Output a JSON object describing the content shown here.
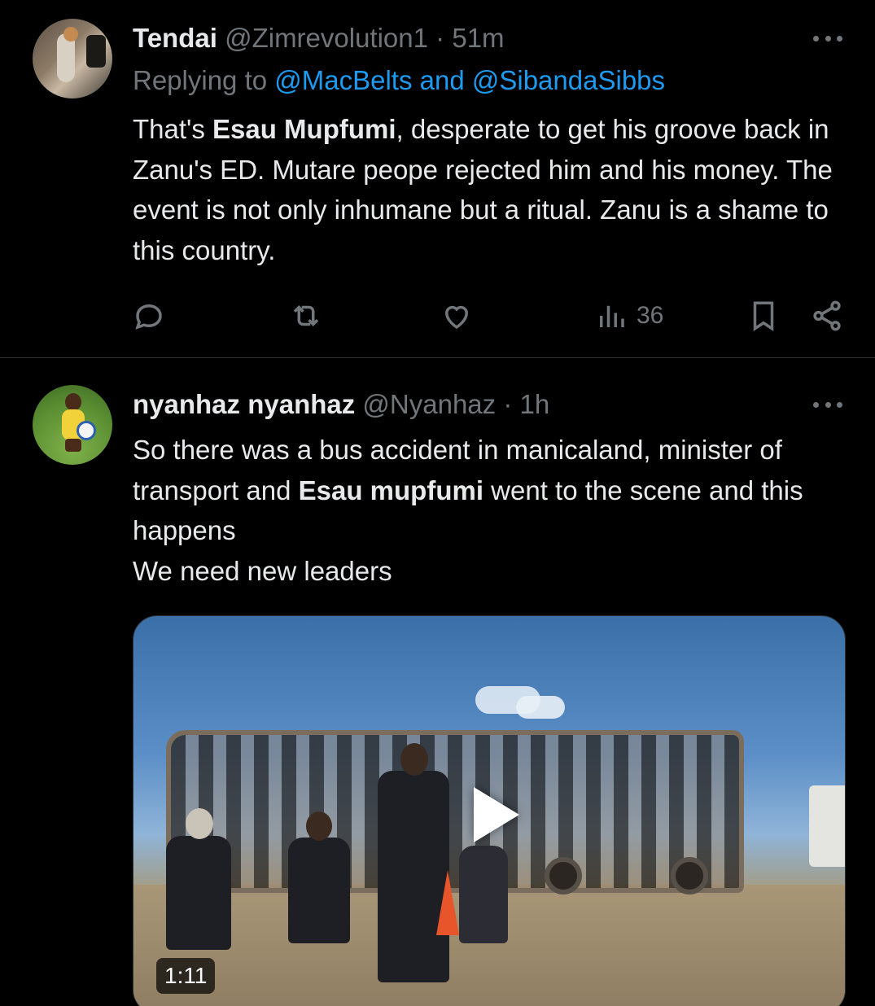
{
  "tweets": [
    {
      "display_name": "Tendai",
      "handle": "@Zimrevolution1",
      "separator": "·",
      "time": "51m",
      "replying_prefix": "Replying to ",
      "replying_to": "@MacBelts and @SibandaSibbs",
      "body": {
        "part1": "That's ",
        "bold": "Esau Mupfumi",
        "part2": ", desperate to get his groove back in Zanu's ED. Mutare peope rejected him and his money. The event is not only inhumane but a ritual. Zanu is a shame to this country."
      },
      "views": "36"
    },
    {
      "display_name": "nyanhaz nyanhaz",
      "handle": "@Nyanhaz",
      "separator": "·",
      "time": "1h",
      "body": {
        "part1": "So there was a bus accident in manicaland, minister of transport and ",
        "bold": "Esau mupfumi",
        "part2": " went to the scene and this happens",
        "line4": "We need new leaders"
      },
      "video_duration": "1:11"
    }
  ],
  "colors": {
    "background": "#000000",
    "text": "#e7e9ea",
    "muted": "#71767b",
    "accent": "#1d9bf0",
    "divider": "#2f3336"
  }
}
